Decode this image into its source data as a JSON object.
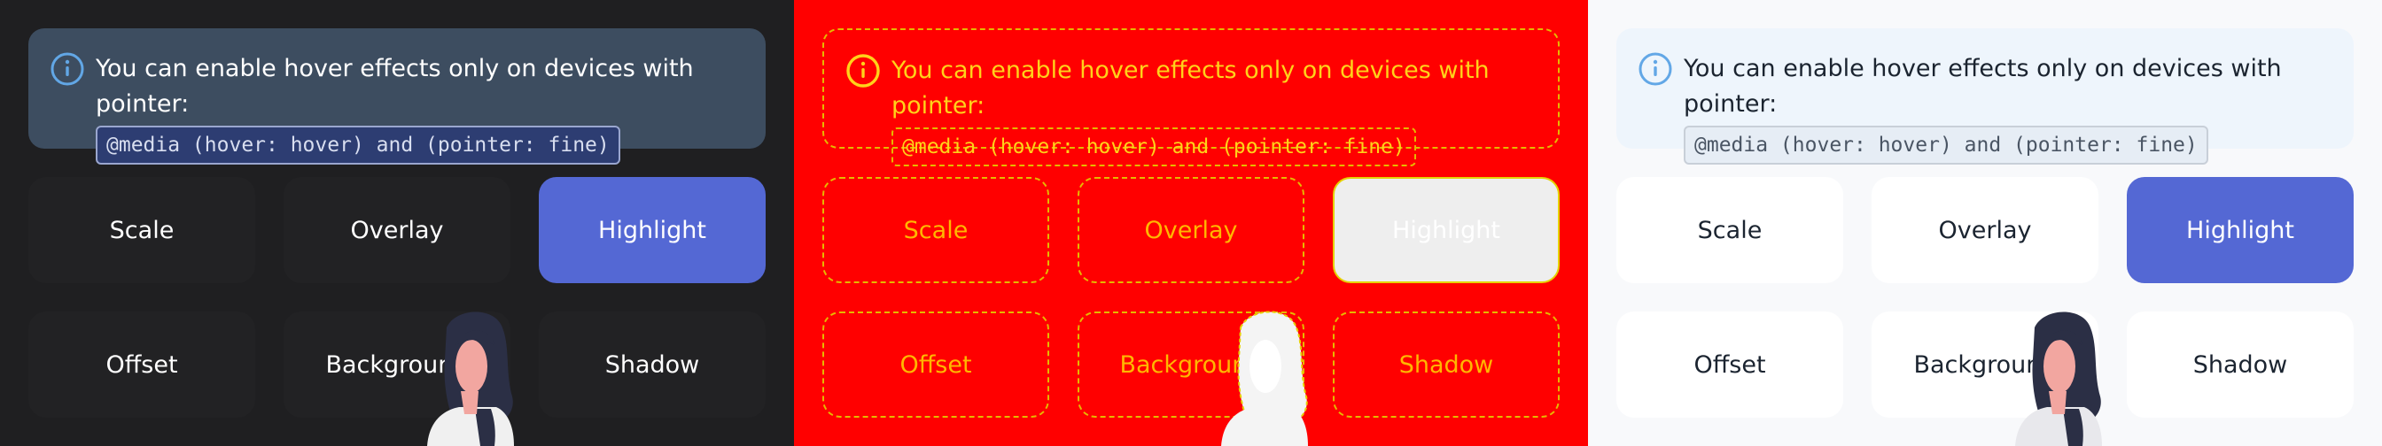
{
  "notice": {
    "message": "You can enable hover effects only on devices with pointer:",
    "code": "@media (hover: hover) and (pointer: fine)",
    "icon": "info-icon"
  },
  "tiles": {
    "scale": "Scale",
    "overlay": "Overlay",
    "highlight": "Highlight",
    "offset": "Offset",
    "background": "Background",
    "shadow": "Shadow"
  },
  "themes": {
    "dark": {
      "bg": "#1f1f21",
      "accent": "#5468d4",
      "notice_bg": "#3d4d60"
    },
    "red": {
      "bg": "#ff0000",
      "outline": "#e6b800",
      "text": "#ffd21a"
    },
    "light": {
      "bg": "#f8f9fb",
      "accent": "#5468d4",
      "notice_bg": "#eef5fc"
    }
  }
}
